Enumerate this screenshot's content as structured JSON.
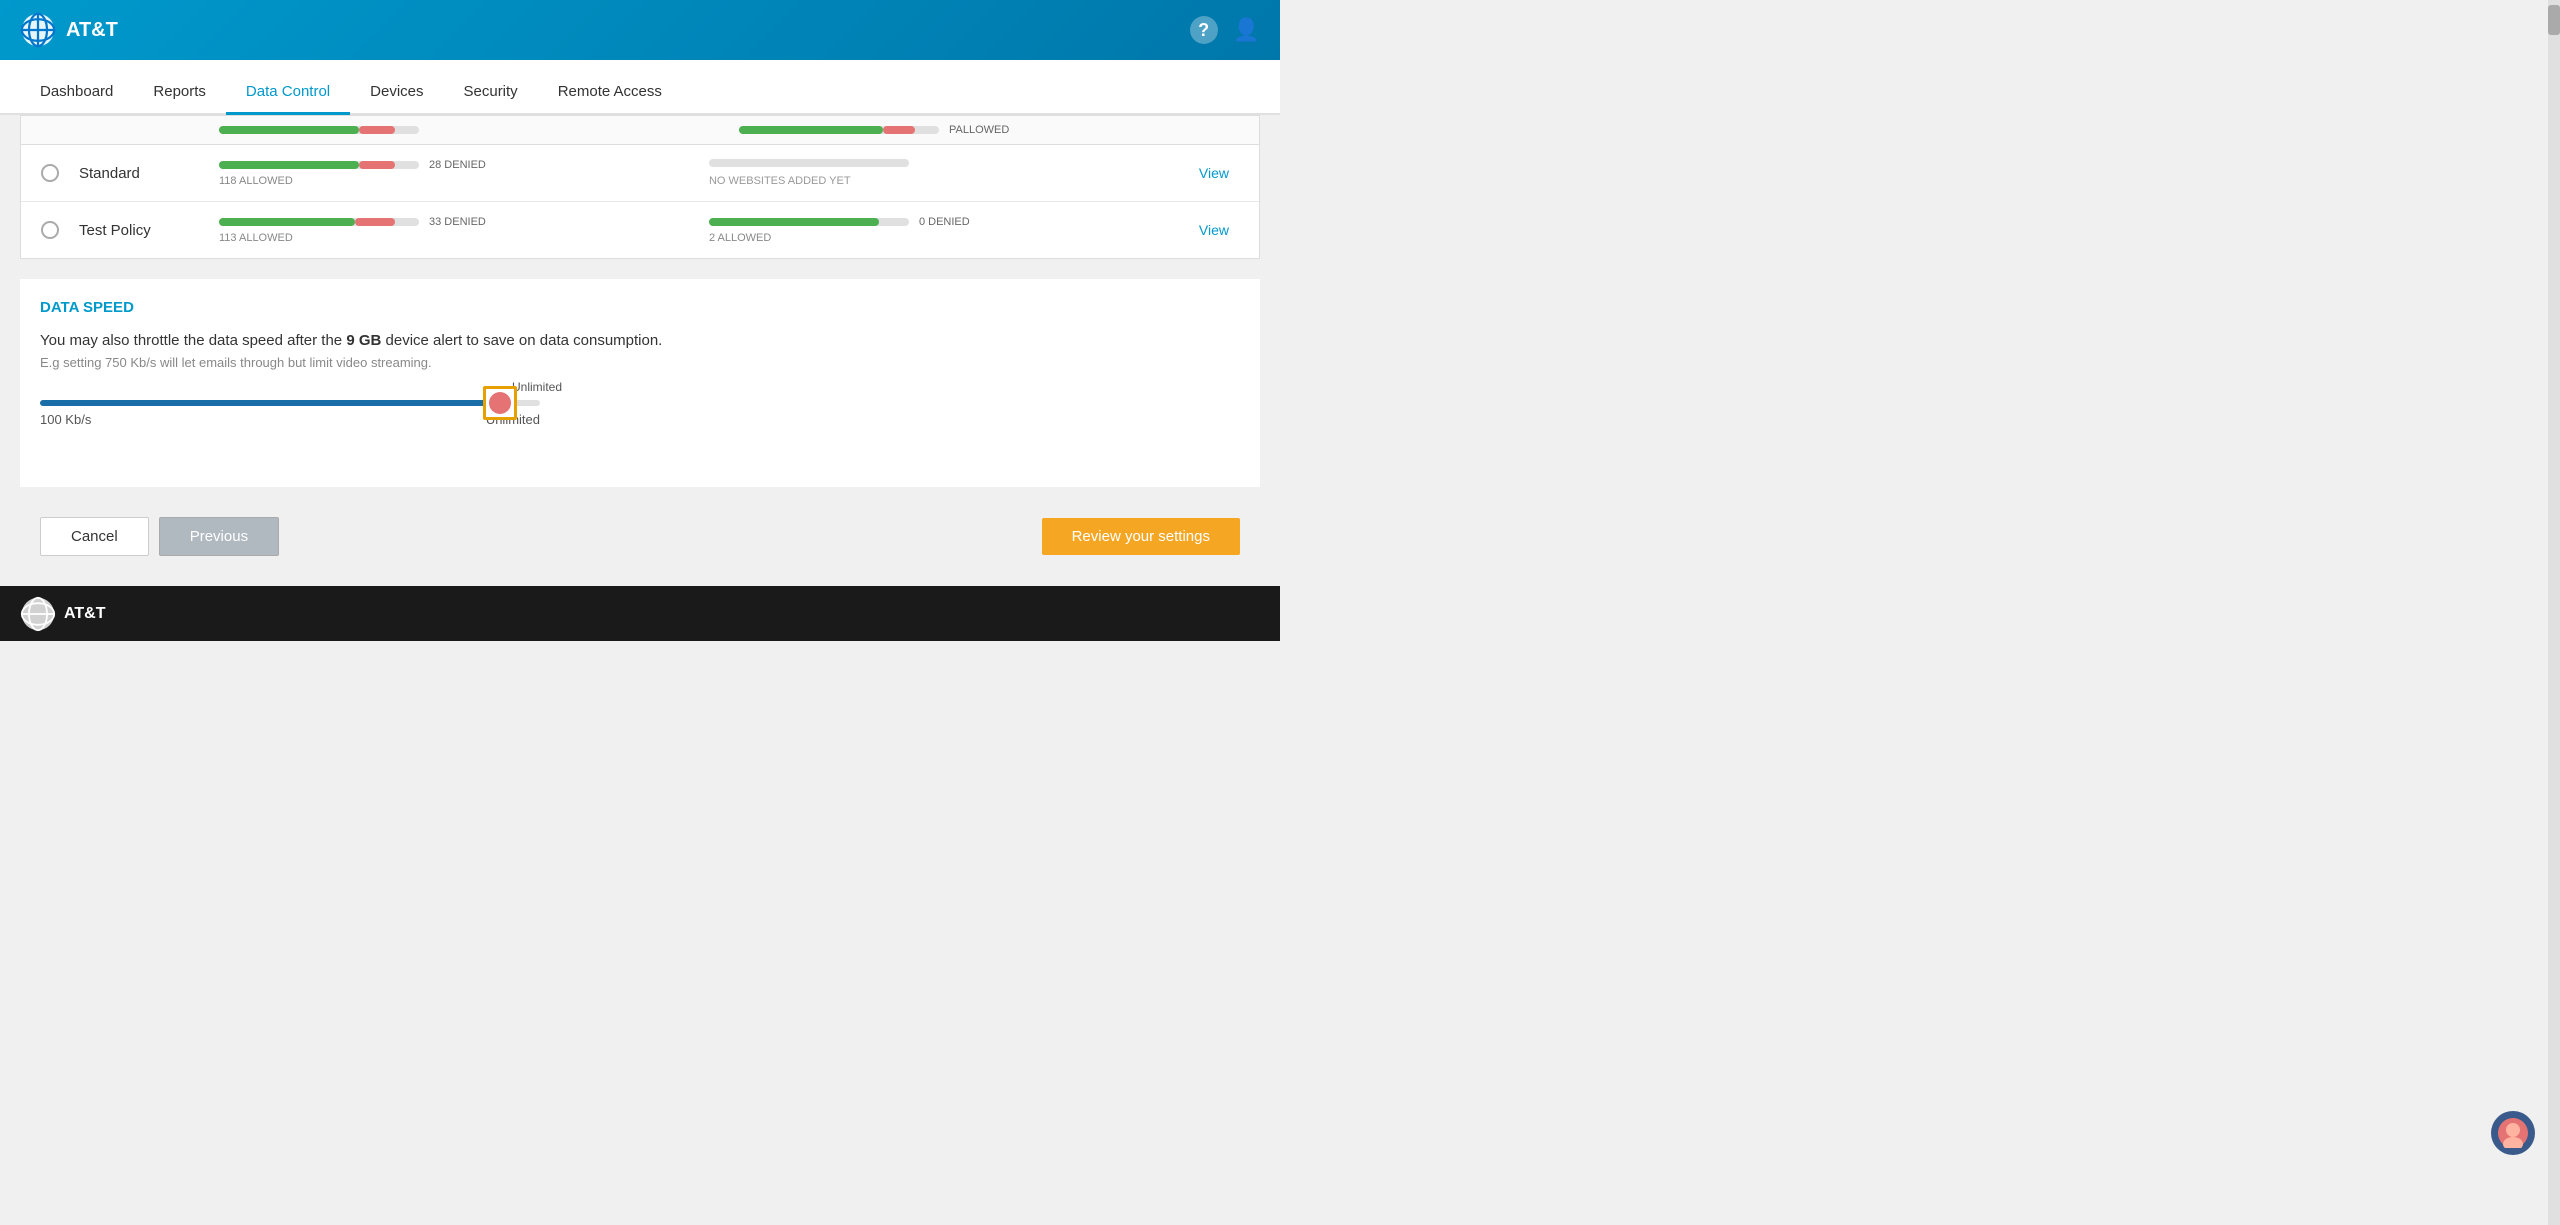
{
  "header": {
    "brand": "AT&T",
    "help_icon": "?",
    "user_icon": "👤"
  },
  "nav": {
    "items": [
      {
        "id": "dashboard",
        "label": "Dashboard",
        "active": false
      },
      {
        "id": "reports",
        "label": "Reports",
        "active": false
      },
      {
        "id": "data-control",
        "label": "Data Control",
        "active": true
      },
      {
        "id": "devices",
        "label": "Devices",
        "active": false
      },
      {
        "id": "security",
        "label": "Security",
        "active": false
      },
      {
        "id": "remote-access",
        "label": "Remote Access",
        "active": false
      }
    ]
  },
  "policy_table": {
    "header_allowed": "ALLOWED",
    "header_denied": "DENIED",
    "rows": [
      {
        "name": "Standard",
        "radio_checked": false,
        "bar1_green_pct": 70,
        "bar1_red_pct": 18,
        "bar1_allowed": "118 ALLOWED",
        "bar1_denied": "28 DENIED",
        "bar2_type": "empty",
        "bar2_text": "NO WEBSITES ADDED YET",
        "view": "View"
      },
      {
        "name": "Test Policy",
        "radio_checked": false,
        "bar1_green_pct": 68,
        "bar1_red_pct": 20,
        "bar1_allowed": "113 ALLOWED",
        "bar1_denied": "33 DENIED",
        "bar2_type": "filled",
        "bar2_green_pct": 85,
        "bar2_allowed": "2 ALLOWED",
        "bar2_denied": "0 DENIED",
        "view": "View"
      }
    ]
  },
  "data_speed": {
    "title": "DATA SPEED",
    "description_before": "You may also throttle the data speed after the ",
    "highlight": "9 GB",
    "description_after": " device alert to save on data consumption.",
    "hint": "E.g setting 750 Kb/s will let emails through but limit video streaming.",
    "slider_label_top": "Unlimited",
    "slider_min": "100 Kb/s",
    "slider_max": "Unlimited",
    "slider_value_pct": 92
  },
  "buttons": {
    "cancel": "Cancel",
    "previous": "Previous",
    "review": "Review your settings"
  },
  "footer": {
    "brand": "AT&T"
  }
}
